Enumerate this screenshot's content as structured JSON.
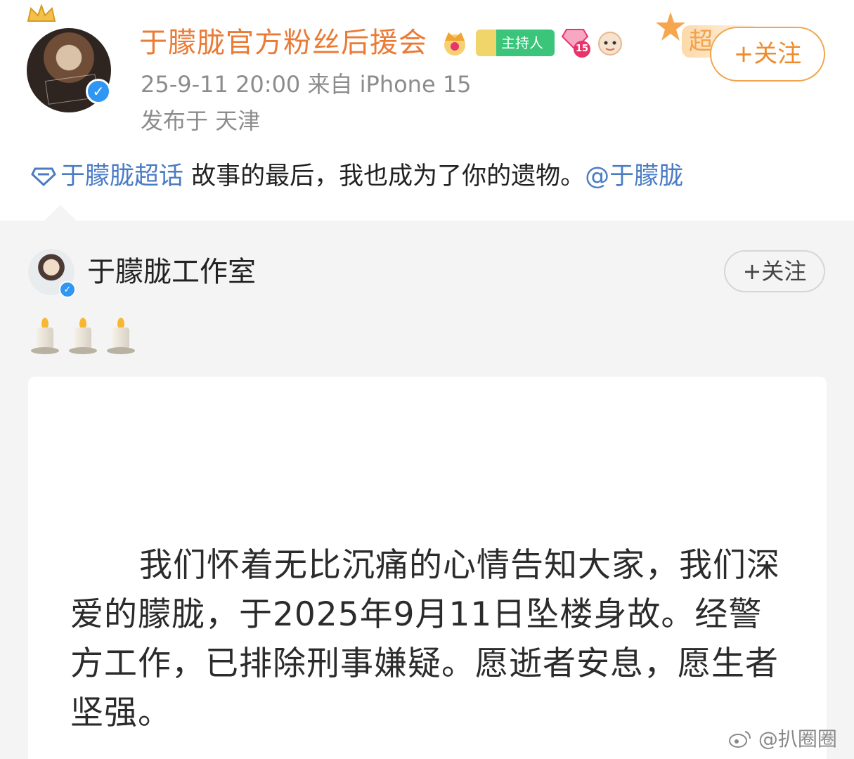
{
  "post": {
    "author": "于朦胧官方粉丝后援会",
    "badge_host": "主持人",
    "badge_level": "15",
    "meta": "25-9-11 20:00  来自 iPhone 15",
    "location": "发布于 天津",
    "super_chip": "超",
    "follow_label": "+关注",
    "topic": "于朦胧超话",
    "text": " 故事的最后，我也成为了你的遗物。",
    "mention": "@于朦胧"
  },
  "repost": {
    "author": "于朦胧工作室",
    "follow_label": "+关注",
    "announcement": "我们怀着无比沉痛的心情告知大家，我们深爱的朦胧，于2025年9月11日坠楼身故。经警方工作，已排除刑事嫌疑。愿逝者安息，愿生者坚强。"
  },
  "watermark": "@扒圈圈",
  "icons": [
    "crown-icon",
    "host-badge-icon",
    "level-badge-icon",
    "mascot-icon",
    "verified-icon",
    "topic-diamond-icon",
    "candle-icon",
    "weibo-logo-icon"
  ],
  "colors": {
    "author_orange": "#eb7a35",
    "link_blue": "#4a7cc4",
    "verified_blue": "#2f96f3",
    "follow_border": "#f2a44a",
    "repost_bg": "#f4f4f4"
  }
}
